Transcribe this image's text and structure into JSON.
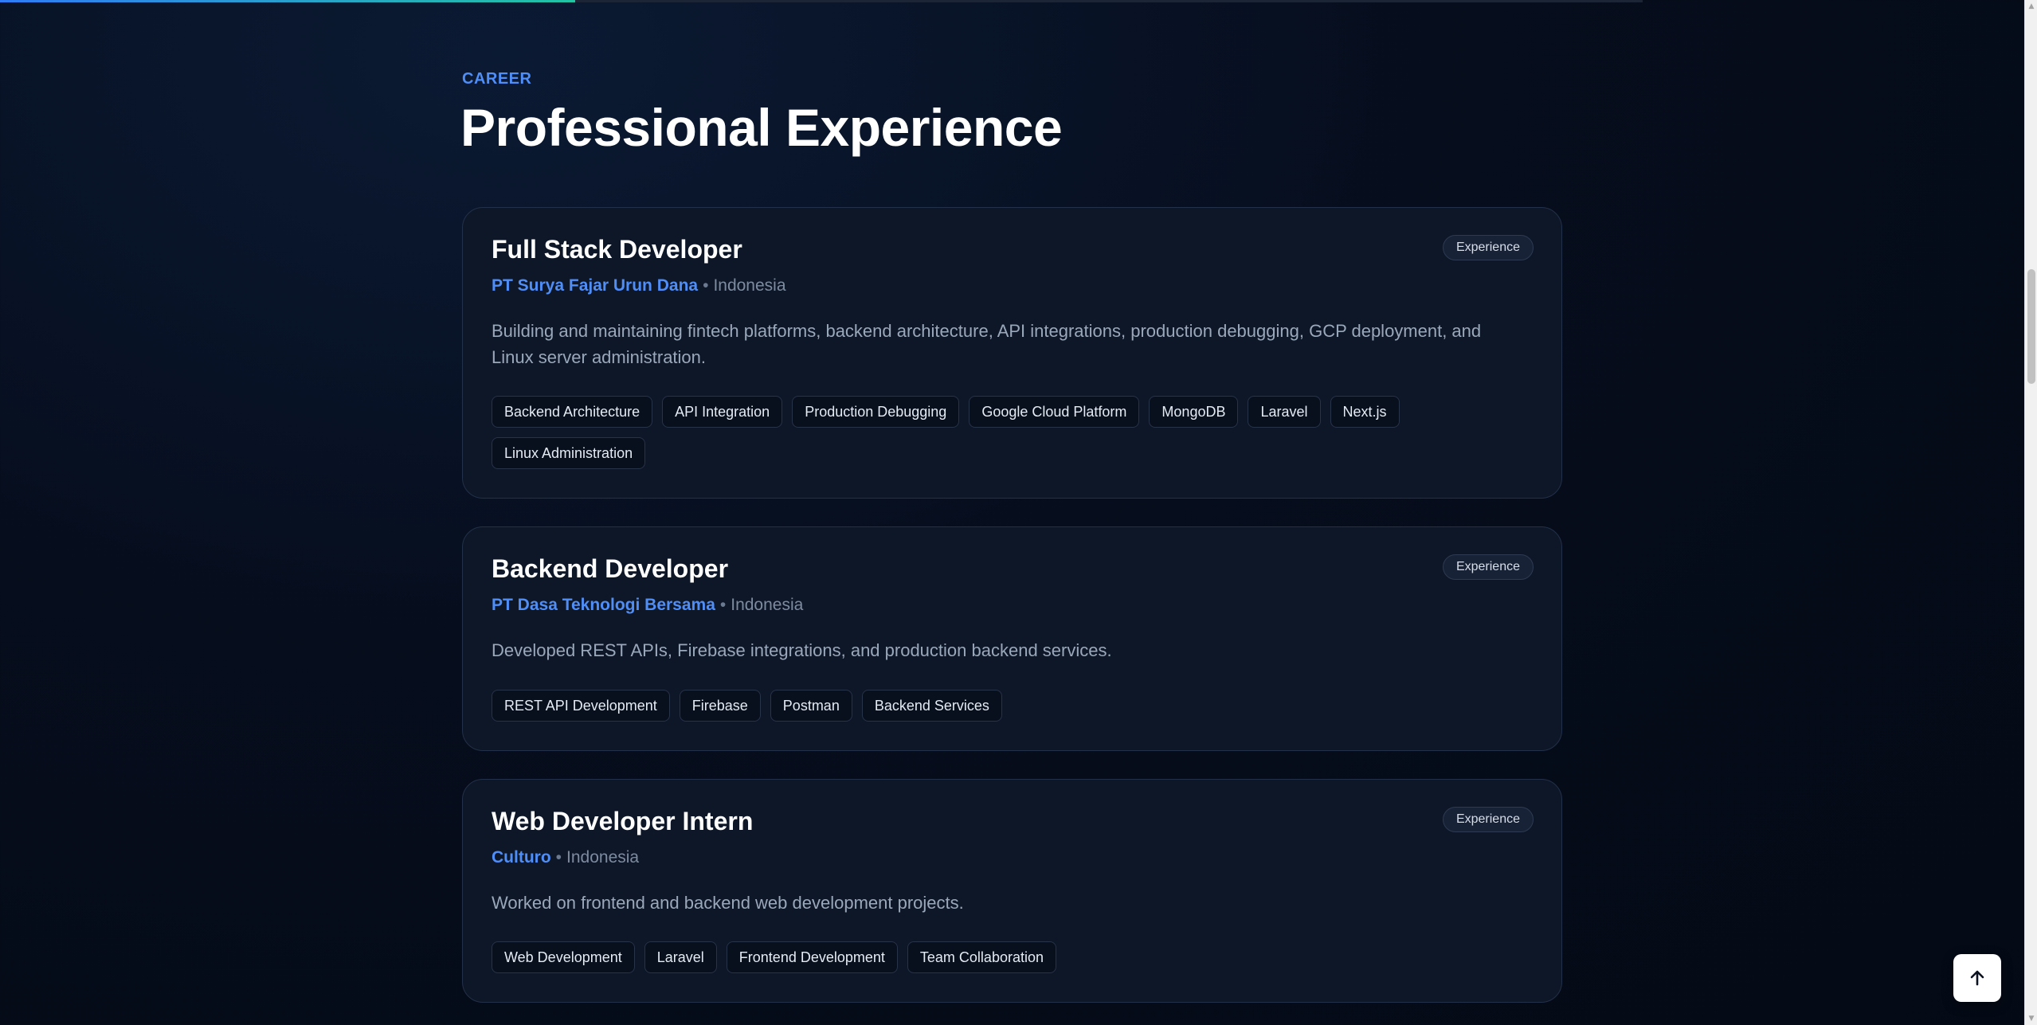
{
  "progress": {
    "fraction": 0.35,
    "fill_color": "#2f7cf6",
    "fill_color_end": "#22c3a4"
  },
  "section": {
    "eyebrow": "CAREER",
    "title": "Professional Experience"
  },
  "experiences": [
    {
      "title": "Full Stack Developer",
      "company": "PT Surya Fajar Urun Dana",
      "separator": "•",
      "location": "Indonesia",
      "badge": "Experience",
      "description": "Building and maintaining fintech platforms, backend architecture, API integrations, production debugging, GCP deployment, and Linux server administration.",
      "tags": [
        "Backend Architecture",
        "API Integration",
        "Production Debugging",
        "Google Cloud Platform",
        "MongoDB",
        "Laravel",
        "Next.js",
        "Linux Administration"
      ]
    },
    {
      "title": "Backend Developer",
      "company": "PT Dasa Teknologi Bersama",
      "separator": "•",
      "location": "Indonesia",
      "badge": "Experience",
      "description": "Developed REST APIs, Firebase integrations, and production backend services.",
      "tags": [
        "REST API Development",
        "Firebase",
        "Postman",
        "Backend Services"
      ]
    },
    {
      "title": "Web Developer Intern",
      "company": "Culturo",
      "separator": "•",
      "location": "Indonesia",
      "badge": "Experience",
      "description": "Worked on frontend and backend web development projects.",
      "tags": [
        "Web Development",
        "Laravel",
        "Frontend Development",
        "Team Collaboration"
      ]
    }
  ],
  "back_to_top": {
    "icon": "arrow-up-icon"
  },
  "colors": {
    "accent": "#4f8ef7",
    "card_bg": "#0e1728",
    "page_bg": "#060d1c"
  }
}
